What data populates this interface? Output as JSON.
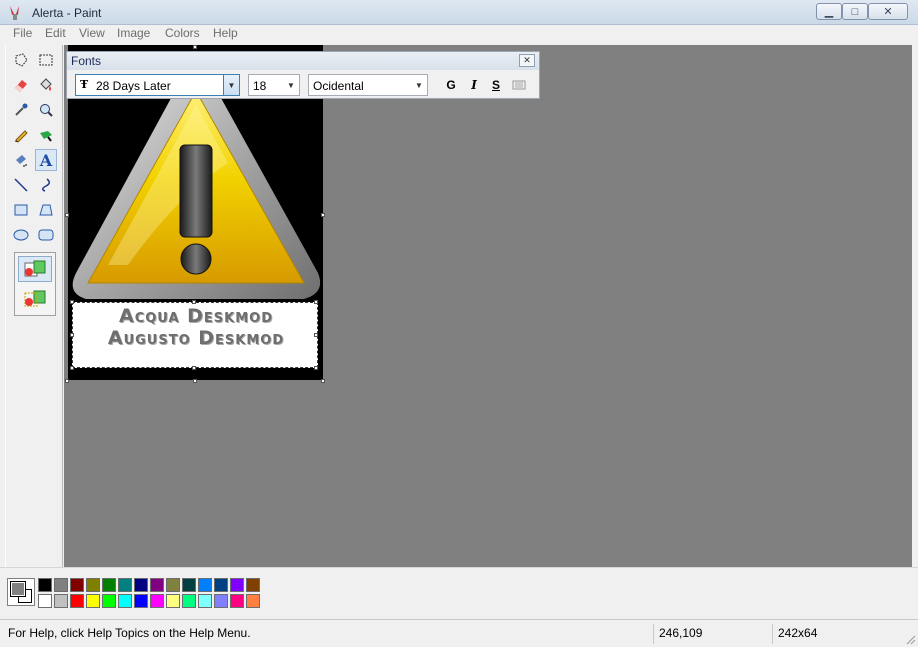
{
  "window": {
    "title": "Alerta - Paint"
  },
  "menu": [
    "File",
    "Edit",
    "View",
    "Image",
    "Colors",
    "Help"
  ],
  "tools": [
    "free-select",
    "rect-select",
    "eraser",
    "fill-bucket",
    "color-picker",
    "magnifier",
    "pencil",
    "brush",
    "airbrush",
    "text",
    "line",
    "curve",
    "rectangle",
    "polygon",
    "ellipse",
    "rounded-rectangle"
  ],
  "active_tool": "text",
  "fonts_toolbar": {
    "title": "Fonts",
    "font_name": "28 Days Later",
    "font_size": "18",
    "script": "Ocidental",
    "bold_label": "G",
    "italic_label": "I",
    "underline_label": "S"
  },
  "canvas_text": {
    "line1": "Acqua Deskmod",
    "line2": "Augusto Deskmod"
  },
  "palette": {
    "row1": [
      "#000000",
      "#808080",
      "#800000",
      "#808000",
      "#008000",
      "#008080",
      "#000080",
      "#800080",
      "#808040",
      "#004040",
      "#0080ff",
      "#004080",
      "#8000ff",
      "#804000"
    ],
    "row2": [
      "#ffffff",
      "#c0c0c0",
      "#ff0000",
      "#ffff00",
      "#00ff00",
      "#00ffff",
      "#0000ff",
      "#ff00ff",
      "#ffff80",
      "#00ff80",
      "#80ffff",
      "#8080ff",
      "#ff0080",
      "#ff8040"
    ],
    "foreground": "#808080",
    "background": "#ffffff"
  },
  "status": {
    "help": "For Help, click Help Topics on the Help Menu.",
    "coords": "246,109",
    "size": "242x64"
  }
}
